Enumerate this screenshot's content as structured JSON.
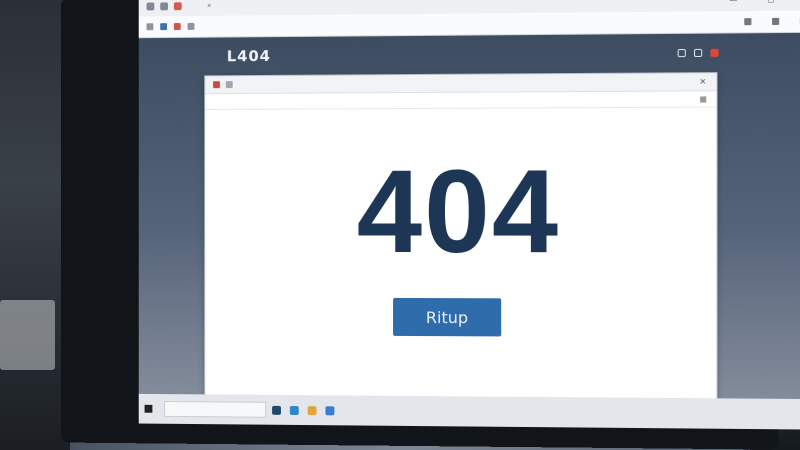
{
  "browser": {
    "tab_title": "",
    "address_text": "",
    "accent_red": "#d45a4c",
    "accent_blue": "#3d6fb3"
  },
  "site": {
    "logo": "L404",
    "nav_text": "",
    "icons": [
      "chat-icon",
      "grid-icon",
      "notification-icon"
    ]
  },
  "inner_browser": {
    "tab_title": "",
    "address_text": ""
  },
  "page": {
    "error_code": "404",
    "button_label": "Ritup",
    "error_color": "#1d3656",
    "button_color": "#2f6cab"
  },
  "taskbar": {
    "search_text": "",
    "apps": [
      "task-view-icon",
      "edge-icon",
      "file-explorer-icon",
      "store-icon"
    ]
  }
}
